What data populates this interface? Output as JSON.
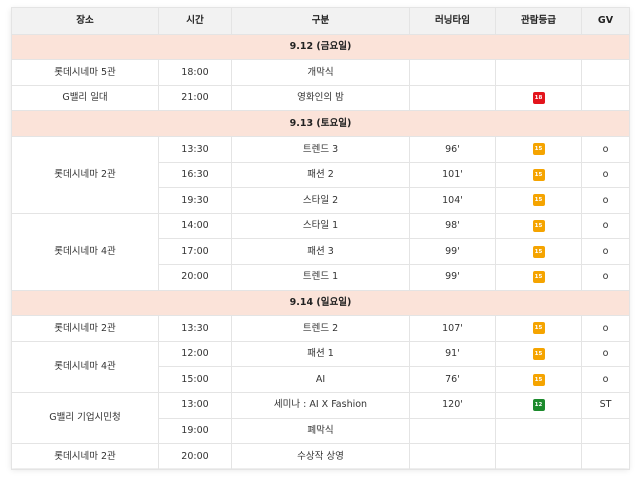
{
  "colors": {
    "header_bg": "#f2f2f2",
    "day_row_bg": "#fbe3d9",
    "rating_15": "#f5a400",
    "rating_18": "#e3141c",
    "rating_12": "#1c8a2c"
  },
  "headers": {
    "venue": "장소",
    "time": "시간",
    "type": "구분",
    "running_time": "러닝타임",
    "rating": "관람등급",
    "gv": "GV"
  },
  "days": [
    {
      "label": "9.12 (금요일)",
      "groups": [
        {
          "venue": "롯데시네마 5관",
          "rows": [
            {
              "time": "18:00",
              "type": "개막식",
              "running_time": "",
              "rating": "",
              "gv": ""
            }
          ]
        },
        {
          "venue": "G밸리 일대",
          "rows": [
            {
              "time": "21:00",
              "type": "영화인의 밤",
              "running_time": "",
              "rating": "18",
              "gv": ""
            }
          ]
        }
      ]
    },
    {
      "label": "9.13 (토요일)",
      "groups": [
        {
          "venue": "롯데시네마 2관",
          "rows": [
            {
              "time": "13:30",
              "type": "트렌드 3",
              "running_time": "96'",
              "rating": "15",
              "gv": "o"
            },
            {
              "time": "16:30",
              "type": "패션 2",
              "running_time": "101'",
              "rating": "15",
              "gv": "o"
            },
            {
              "time": "19:30",
              "type": "스타일 2",
              "running_time": "104'",
              "rating": "15",
              "gv": "o"
            }
          ]
        },
        {
          "venue": "롯데시네마 4관",
          "rows": [
            {
              "time": "14:00",
              "type": "스타일 1",
              "running_time": "98'",
              "rating": "15",
              "gv": "o"
            },
            {
              "time": "17:00",
              "type": "패션 3",
              "running_time": "99'",
              "rating": "15",
              "gv": "o"
            },
            {
              "time": "20:00",
              "type": "트렌드 1",
              "running_time": "99'",
              "rating": "15",
              "gv": "o"
            }
          ]
        }
      ]
    },
    {
      "label": "9.14 (일요일)",
      "groups": [
        {
          "venue": "롯데시네마 2관",
          "rows": [
            {
              "time": "13:30",
              "type": "트렌드 2",
              "running_time": "107'",
              "rating": "15",
              "gv": "o"
            }
          ]
        },
        {
          "venue": "롯데시네마 4관",
          "rows": [
            {
              "time": "12:00",
              "type": "패션 1",
              "running_time": "91'",
              "rating": "15",
              "gv": "o"
            },
            {
              "time": "15:00",
              "type": "AI",
              "running_time": "76'",
              "rating": "15",
              "gv": "o"
            }
          ]
        },
        {
          "venue": "G밸리 기업시민청",
          "rows": [
            {
              "time": "13:00",
              "type": "세미나 : AI X Fashion",
              "running_time": "120'",
              "rating": "12",
              "gv": "ST"
            },
            {
              "time": "19:00",
              "type": "폐막식",
              "running_time": "",
              "rating": "",
              "gv": ""
            }
          ]
        },
        {
          "venue": "롯데시네마 2관",
          "rows": [
            {
              "time": "20:00",
              "type": "수상작 상영",
              "running_time": "",
              "rating": "",
              "gv": ""
            }
          ]
        }
      ]
    }
  ]
}
